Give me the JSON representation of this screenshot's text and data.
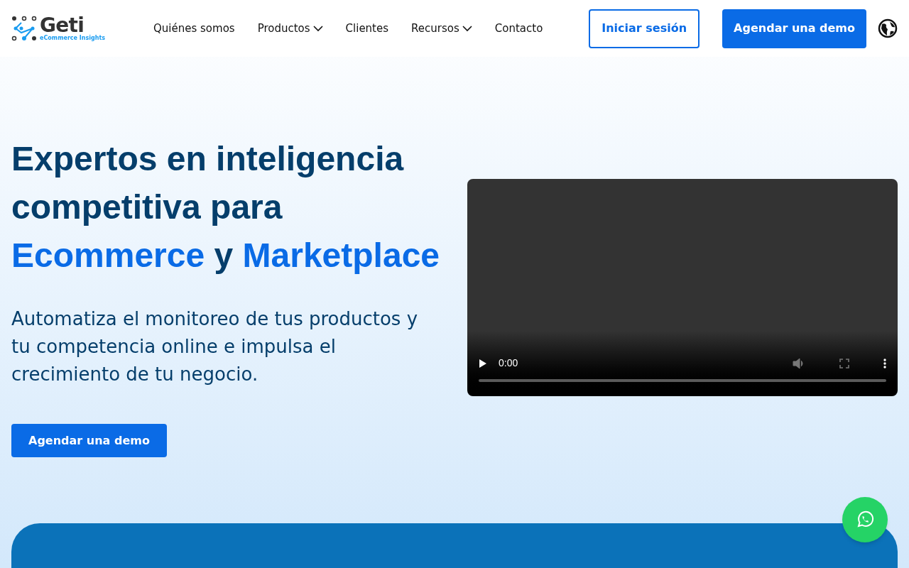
{
  "logo": {
    "name": "Geti",
    "tagline": "eCommerce Insights"
  },
  "nav": [
    {
      "label": "Quiénes somos",
      "has_menu": false
    },
    {
      "label": "Productos",
      "has_menu": true
    },
    {
      "label": "Clientes",
      "has_menu": false
    },
    {
      "label": "Recursos",
      "has_menu": true
    },
    {
      "label": "Contacto",
      "has_menu": false
    }
  ],
  "login_button": "Iniciar sesión",
  "demo_button": "Agendar una demo",
  "hero": {
    "headline": [
      {
        "text": "Expertos en inteligencia competitiva para",
        "kind": "plain"
      },
      {
        "text": "Ecommerce",
        "kind": "accent"
      },
      {
        "text": "y",
        "kind": "plain"
      },
      {
        "text": "Marketplace",
        "kind": "accent"
      }
    ],
    "subtitle": "Automatiza el monitoreo de tus productos y tu competencia online e impulsa el crecimiento de tu negocio.",
    "cta": "Agendar una demo"
  },
  "video": {
    "time": "0:00"
  }
}
